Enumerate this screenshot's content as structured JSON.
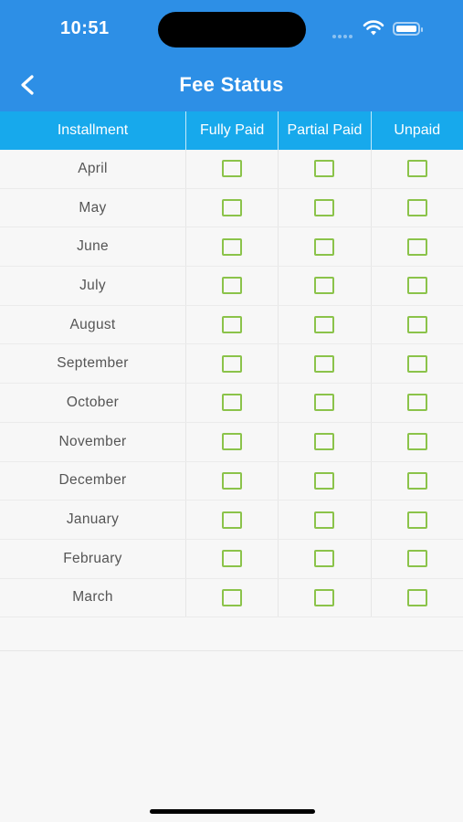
{
  "status_bar": {
    "time": "10:51"
  },
  "header": {
    "title": "Fee Status",
    "back_icon": "chevron-left-icon"
  },
  "colors": {
    "app_bar": "#2d8fe6",
    "table_header": "#17a9ec",
    "checkbox_border": "#8bc34a"
  },
  "table": {
    "columns": [
      "Installment",
      "Fully Paid",
      "Partial Paid",
      "Unpaid"
    ],
    "rows": [
      {
        "month": "April",
        "fully_paid": false,
        "partial_paid": false,
        "unpaid": false
      },
      {
        "month": "May",
        "fully_paid": false,
        "partial_paid": false,
        "unpaid": false
      },
      {
        "month": "June",
        "fully_paid": false,
        "partial_paid": false,
        "unpaid": false
      },
      {
        "month": "July",
        "fully_paid": false,
        "partial_paid": false,
        "unpaid": false
      },
      {
        "month": "August",
        "fully_paid": false,
        "partial_paid": false,
        "unpaid": false
      },
      {
        "month": "September",
        "fully_paid": false,
        "partial_paid": false,
        "unpaid": false
      },
      {
        "month": "October",
        "fully_paid": false,
        "partial_paid": false,
        "unpaid": false
      },
      {
        "month": "November",
        "fully_paid": false,
        "partial_paid": false,
        "unpaid": false
      },
      {
        "month": "December",
        "fully_paid": false,
        "partial_paid": false,
        "unpaid": false
      },
      {
        "month": "January",
        "fully_paid": false,
        "partial_paid": false,
        "unpaid": false
      },
      {
        "month": "February",
        "fully_paid": false,
        "partial_paid": false,
        "unpaid": false
      },
      {
        "month": "March",
        "fully_paid": false,
        "partial_paid": false,
        "unpaid": false
      }
    ]
  }
}
